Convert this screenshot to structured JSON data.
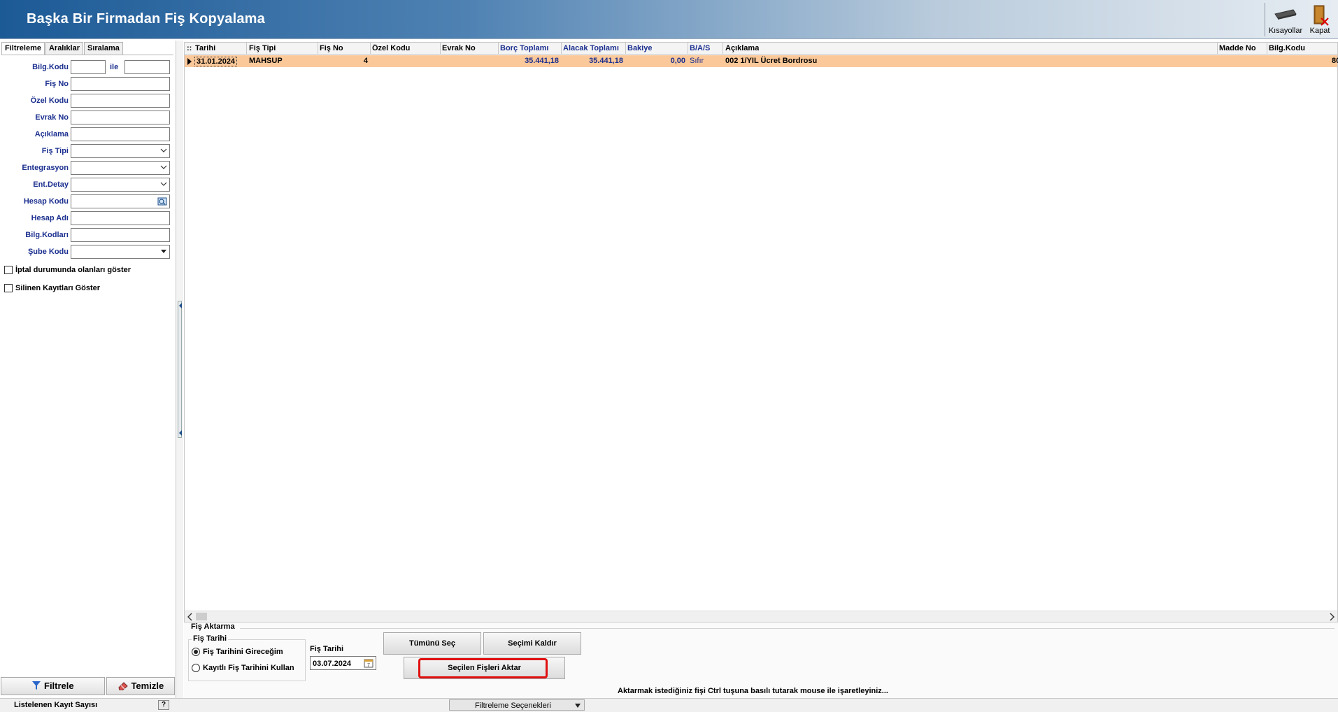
{
  "window": {
    "title": "Başka Bir Firmadan Fiş Kopyalama",
    "toolbar": {
      "shortcuts_label": "Kısayollar",
      "close_label": "Kapat"
    }
  },
  "left_panel": {
    "tabs": [
      "Filtreleme",
      "Aralıklar",
      "Sıralama"
    ],
    "fields": {
      "bilg_kodu": "Bilg.Kodu",
      "ile": "ile",
      "fis_no": "Fiş No",
      "ozel_kodu": "Özel Kodu",
      "evrak_no": "Evrak No",
      "aciklama": "Açıklama",
      "fis_tipi": "Fiş Tipi",
      "entegrasyon": "Entegrasyon",
      "ent_detay": "Ent.Detay",
      "hesap_kodu": "Hesap Kodu",
      "hesap_adi": "Hesap Adı",
      "bilg_kodlari": "Bilg.Kodları",
      "sube_kodu": "Şube Kodu"
    },
    "checkboxes": {
      "iptal": "İptal durumunda olanları göster",
      "silinen": "Silinen Kayıtları Göster"
    },
    "buttons": {
      "filter": "Filtrele",
      "clear": "Temizle"
    }
  },
  "grid": {
    "columns": [
      "Tarihi",
      "Fiş Tipi",
      "Fiş No",
      "Özel Kodu",
      "Evrak No",
      "Borç Toplamı",
      "Alacak Toplamı",
      "Bakiye",
      "B/A/S",
      "Açıklama",
      "Madde No",
      "Bilg.Kodu"
    ],
    "rows": [
      {
        "tarihi": "31.01.2024",
        "fis_tipi": "MAHSUP",
        "fis_no": "4",
        "ozel_kodu": "",
        "evrak_no": "",
        "borc": "35.441,18",
        "alacak": "35.441,18",
        "bakiye": "0,00",
        "bas": "Sıfır",
        "aciklama": "002 1/YIL Ücret Bordrosu",
        "madde_no": "",
        "bilg_kodu": "80"
      }
    ]
  },
  "transfer": {
    "group_title": "Fiş Aktarma",
    "date_group_title": "Fiş Tarihi",
    "radio_enter": "Fiş Tarihini Gireceğim",
    "radio_use_saved": "Kayıtlı Fiş Tarihini Kullan",
    "date_label": "Fiş Tarihi",
    "date_value": "03.07.2024",
    "select_all": "Tümünü Seç",
    "clear_selection": "Seçimi Kaldır",
    "transfer_selected": "Seçilen Fişleri Aktar",
    "hint": "Aktarmak istediğiniz fişi Ctrl tuşuna basılı tutarak mouse ile işaretleyiniz..."
  },
  "status": {
    "record_count_label": "Listelenen Kayıt Sayısı",
    "help": "?",
    "filter_options": "Filtreleme Seçenekleri"
  },
  "colors": {
    "selected_row": "#fbc89a",
    "label_blue": "#1b2f8f",
    "highlight_red": "#e01010"
  }
}
